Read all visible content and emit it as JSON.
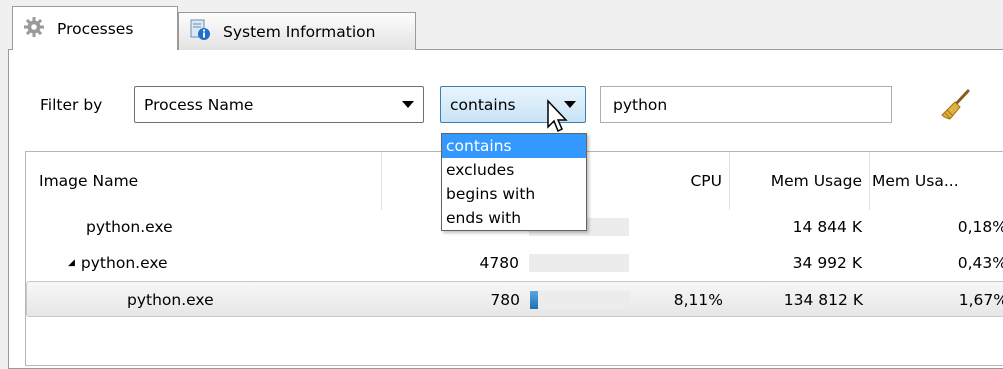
{
  "tabs": [
    {
      "label": "Processes",
      "icon": "gear-icon",
      "active": true
    },
    {
      "label": "System Information",
      "icon": "system-info-icon",
      "active": false
    }
  ],
  "filter": {
    "label": "Filter by",
    "field_value": "Process Name",
    "operator_value": "contains",
    "search_value": "python",
    "operator_options": [
      "contains",
      "excludes",
      "begins with",
      "ends with"
    ]
  },
  "table": {
    "columns": {
      "image_name": "Image Name",
      "cpu": "CPU",
      "mem_usage": "Mem Usage",
      "mem_pct": "Mem Usa..."
    },
    "rows": [
      {
        "name": "python.exe",
        "pid": "",
        "cpu_level": 0,
        "cpu": "",
        "mem": "14 844 K",
        "mem_pct": "0,18%",
        "indent": 1,
        "expander": "",
        "selected": false
      },
      {
        "name": "python.exe",
        "pid": "4780",
        "cpu_level": 0,
        "cpu": "",
        "mem": "34 992 K",
        "mem_pct": "0,43%",
        "indent": 0,
        "expander": "◢",
        "selected": false
      },
      {
        "name": "python.exe",
        "pid": "780",
        "cpu_level": 0.0811,
        "cpu": "8,11%",
        "mem": "134 812 K",
        "mem_pct": "1,67%",
        "indent": 2,
        "expander": "",
        "selected": true
      }
    ]
  },
  "colors": {
    "accent": "#3399ff",
    "cpu_bar": "#1d6fb5",
    "selection": "#e6e6e6"
  }
}
